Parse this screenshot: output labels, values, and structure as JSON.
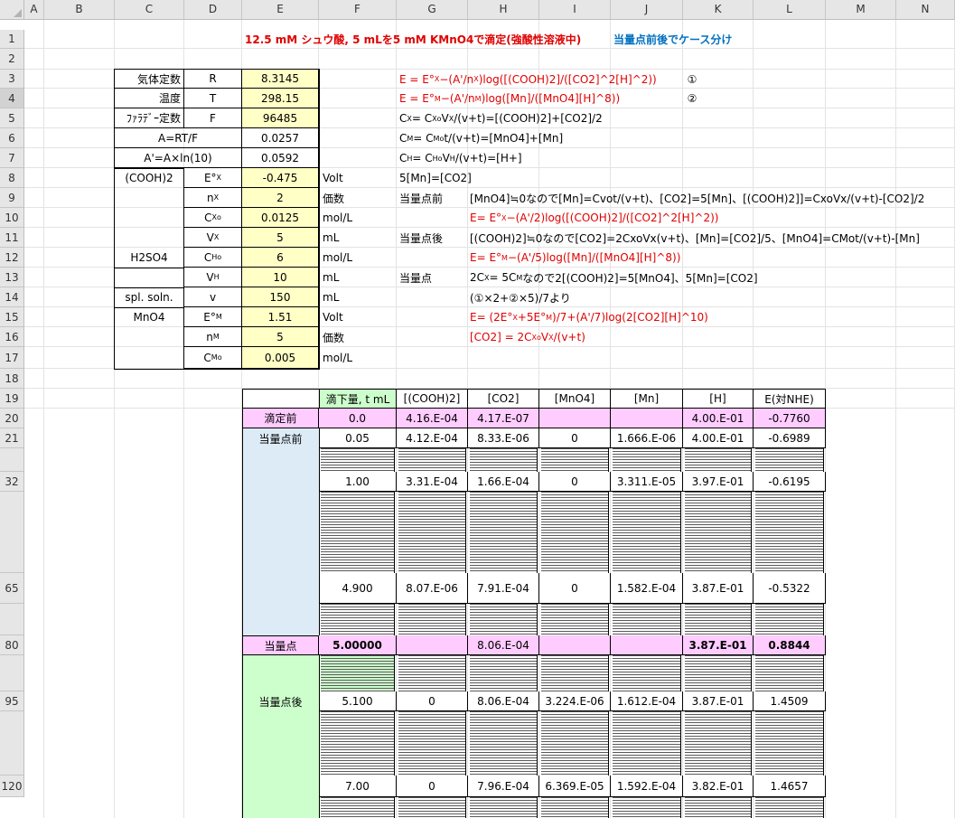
{
  "columns": [
    "A",
    "B",
    "C",
    "D",
    "E",
    "F",
    "G",
    "H",
    "I",
    "J",
    "K",
    "L",
    "M",
    "N"
  ],
  "rows": [
    {
      "label": "1"
    },
    {
      "label": "2"
    },
    {
      "label": "3"
    },
    {
      "label": "4"
    },
    {
      "label": "5"
    },
    {
      "label": "6"
    },
    {
      "label": "7"
    },
    {
      "label": "8"
    },
    {
      "label": "9"
    },
    {
      "label": "10"
    },
    {
      "label": "11"
    },
    {
      "label": "12"
    },
    {
      "label": "13"
    },
    {
      "label": "14"
    },
    {
      "label": "15"
    },
    {
      "label": "16"
    },
    {
      "label": "17"
    },
    {
      "label": "18"
    },
    {
      "label": "19"
    },
    {
      "label": "20"
    },
    {
      "label": "21"
    },
    {
      "label": "32"
    },
    {
      "label": "65"
    },
    {
      "label": "80"
    },
    {
      "label": "95"
    },
    {
      "label": "120"
    }
  ],
  "title": {
    "main": "12.5 mM シュウ酸, 5 mLを5 mM KMnO4で滴定(強酸性溶液中)",
    "note": "当量点前後でケース分け"
  },
  "params": [
    {
      "label": "気体定数",
      "sym": "R",
      "value": "8.3145",
      "unit": ""
    },
    {
      "label": "温度",
      "sym": "T",
      "value": "298.15",
      "unit": ""
    },
    {
      "label": "ﾌｧﾗﾃﾞｰ定数",
      "sym": "F",
      "value": "96485",
      "unit": ""
    },
    {
      "label": "A=RT/F",
      "sym": "",
      "value": "0.0257",
      "unit": ""
    },
    {
      "label": "A'=A×ln(10)",
      "sym": "",
      "value": "0.0592",
      "unit": ""
    },
    {
      "label": "(COOH)2",
      "sym": "E°X",
      "value": "-0.475",
      "unit": "Volt"
    },
    {
      "label": "",
      "sym": "nX",
      "value": "2",
      "unit": "価数"
    },
    {
      "label": "",
      "sym": "CXo",
      "value": "0.0125",
      "unit": "mol/L"
    },
    {
      "label": "",
      "sym": "VX",
      "value": "5",
      "unit": "mL"
    },
    {
      "label": "H2SO4",
      "sym": "CHo",
      "value": "6",
      "unit": "mol/L"
    },
    {
      "label": "",
      "sym": "VH",
      "value": "10",
      "unit": "mL"
    },
    {
      "label": "spl. soln.",
      "sym": "v",
      "value": "150",
      "unit": "mL"
    },
    {
      "label": "MnO4",
      "sym": "E°M",
      "value": "1.51",
      "unit": "Volt"
    },
    {
      "label": "",
      "sym": "nM",
      "value": "5",
      "unit": "価数"
    },
    {
      "label": "",
      "sym": "CMo",
      "value": "0.005",
      "unit": "mol/L"
    }
  ],
  "equations": {
    "e1": "E = E°X−(A'/nX)log([(COOH)2]/([CO2]^2[H]^2))",
    "e1_mark": "①",
    "e2": "E = E°M−(A'/nM)log([Mn]/([MnO4][H]^8))",
    "e2_mark": "②",
    "bal_x": "CX = CXoVX/(v+t)=[(COOH)2]+[CO2]/2",
    "bal_m": "CM = CMot/(v+t)=[MnO4]+[Mn]",
    "bal_h": "CH = CHoVH/(v+t)=[H+]",
    "rel": "5[Mn]=[CO2]",
    "before_label": "当量点前",
    "before_text": "[MnO4]≒0なので[Mn]=Cvot/(v+t)、[CO2]=5[Mn]、[(COOH)2]]=CxoVx/(v+t)-[CO2]/2",
    "before_eq": "E= E°X−(A'/2)log([(COOH)2]/([CO2]^2[H]^2))",
    "after_label": "当量点後",
    "after_text": "[(COOH)2]≒0なので[CO2]=2CxoVx(v+t)、[Mn]=[CO2]/5、[MnO4]=CMot/(v+t)-[Mn]",
    "after_eq": "E= E°M−(A'/5)log([Mn]/([MnO4][H]^8))",
    "eq_label": "当量点",
    "eq_text": "2CX = 5CM なので2[(COOH)2]=5[MnO4]、5[Mn]=[CO2]",
    "eq_text2": "(①×2+②×5)/7より",
    "eq_eq": "E= (2E°X+5E°M)/7+(A'/7)log(2[CO2][H]^10)",
    "eq_co2": "[CO2] = 2CXoVX/(v+t)"
  },
  "table": {
    "headers": [
      "滴下量, t mL",
      "[(COOH)2]",
      "[CO2]",
      "[MnO4]",
      "[Mn]",
      "[H]",
      "E(対NHE)"
    ],
    "before_titration": {
      "label": "滴定前",
      "t": "0.0",
      "cooh": "4.16.E-04",
      "co2": "4.17.E-07",
      "mno4": "",
      "mn": "",
      "h": "4.00.E-01",
      "e": "-0.7760"
    },
    "pre_label": "当量点前",
    "pre_rows": [
      {
        "t": "0.05",
        "cooh": "4.12.E-04",
        "co2": "8.33.E-06",
        "mno4": "0",
        "mn": "1.666.E-06",
        "h": "4.00.E-01",
        "e": "-0.6989"
      },
      {
        "t": "1.00",
        "cooh": "3.31.E-04",
        "co2": "1.66.E-04",
        "mno4": "0",
        "mn": "3.311.E-05",
        "h": "3.97.E-01",
        "e": "-0.6195"
      },
      {
        "t": "4.900",
        "cooh": "8.07.E-06",
        "co2": "7.91.E-04",
        "mno4": "0",
        "mn": "1.582.E-04",
        "h": "3.87.E-01",
        "e": "-0.5322"
      }
    ],
    "equiv": {
      "label": "当量点",
      "t": "5.00000",
      "cooh": "",
      "co2": "8.06.E-04",
      "mno4": "",
      "mn": "",
      "h": "3.87.E-01",
      "e": "0.8844"
    },
    "post_label": "当量点後",
    "post_rows": [
      {
        "t": "5.100",
        "cooh": "0",
        "co2": "8.06.E-04",
        "mno4": "3.224.E-06",
        "mn": "1.612.E-04",
        "h": "3.87.E-01",
        "e": "1.4509"
      },
      {
        "t": "7.00",
        "cooh": "0",
        "co2": "7.96.E-04",
        "mno4": "6.369.E-05",
        "mn": "1.592.E-04",
        "h": "3.82.E-01",
        "e": "1.4657"
      }
    ]
  }
}
